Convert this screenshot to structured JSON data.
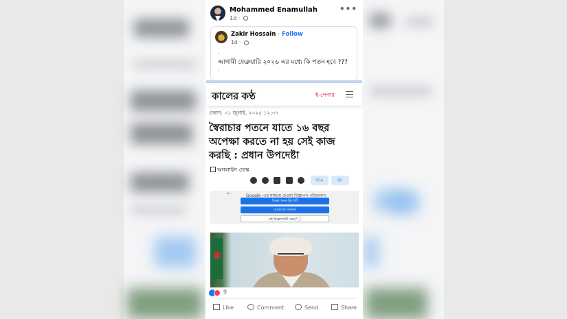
{
  "post": {
    "author_name": "Mohammed Enamullah",
    "time": "1d",
    "more_label": "•••",
    "shared": {
      "author_name": "Zakir Hossain",
      "separator": "·",
      "follow_label": "Follow",
      "time": "1d",
      "dot_line": ".",
      "text": "আগামী ফেব্রুয়ারি ২০২৬ এর মধ্যে কি পতন হবে ???"
    },
    "reactions_count": "9",
    "actions": {
      "like": "Like",
      "comment": "Comment",
      "send": "Send",
      "share": "Share"
    }
  },
  "article": {
    "logo": "কালের কণ্ঠ",
    "epaper_label": "ই-পেপার",
    "published": "প্রকাশ: ০১ জুলাই, ২০২৫ ১২:০৭",
    "headline": "স্বৈরাচার পতনে যাতে ১৬ বছর অপেক্ষা করতে না হয় সেই কাজ করছি : প্রধান উপদেষ্টা",
    "desk": "অনলাইন ডেস্ক",
    "font_decrease": "অ-",
    "font_increase": "অ+",
    "ad": {
      "title": "Google -এর মাধ্যমে দেওয়া বিজ্ঞাপন পরিচালনা",
      "button_1": "বিজ্ঞাপনের রিপোর্ট",
      "button_2": "আমাদের জানান",
      "button_3": "এই বিজ্ঞাপনটি কেন? ⓘ"
    }
  },
  "colors": {
    "facebook_blue": "#1877f2",
    "epaper_red": "#c8102e",
    "love_red": "#f33e58"
  }
}
